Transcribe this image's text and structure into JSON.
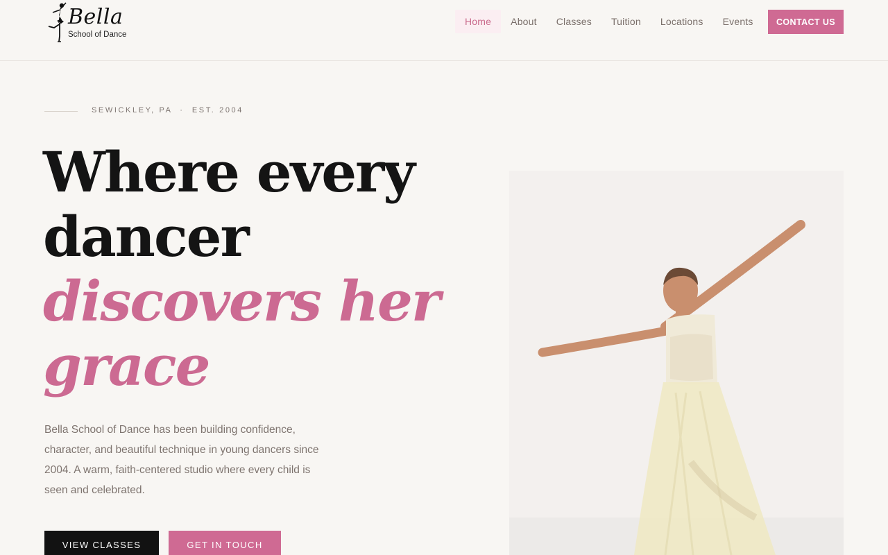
{
  "header": {
    "logo": {
      "name": "Bella",
      "subtitle": "School of Dance"
    },
    "nav": [
      {
        "label": "Home",
        "active": true
      },
      {
        "label": "About",
        "active": false
      },
      {
        "label": "Classes",
        "active": false
      },
      {
        "label": "Tuition",
        "active": false
      },
      {
        "label": "Locations",
        "active": false
      },
      {
        "label": "Events",
        "active": false
      }
    ],
    "contact_label": "CONTACT US"
  },
  "hero": {
    "eyebrow": "SEWICKLEY, PA  ·  EST. 2004",
    "headline": {
      "line1": "Where every",
      "line2": "dancer",
      "line3": "discovers her",
      "line4": "grace"
    },
    "intro": "Bella School of Dance has been building confidence, character, and beautiful technique in young dancers since 2004. A warm, faith-centered studio where every child is seen and celebrated.",
    "buttons": {
      "primary": "VIEW CLASSES",
      "secondary": "GET IN TOUCH"
    }
  },
  "colors": {
    "accent": "#cf6a93",
    "background": "#f8f6f3",
    "dark": "#121212"
  },
  "icons": {
    "logo": "ballerina-silhouette-icon"
  }
}
